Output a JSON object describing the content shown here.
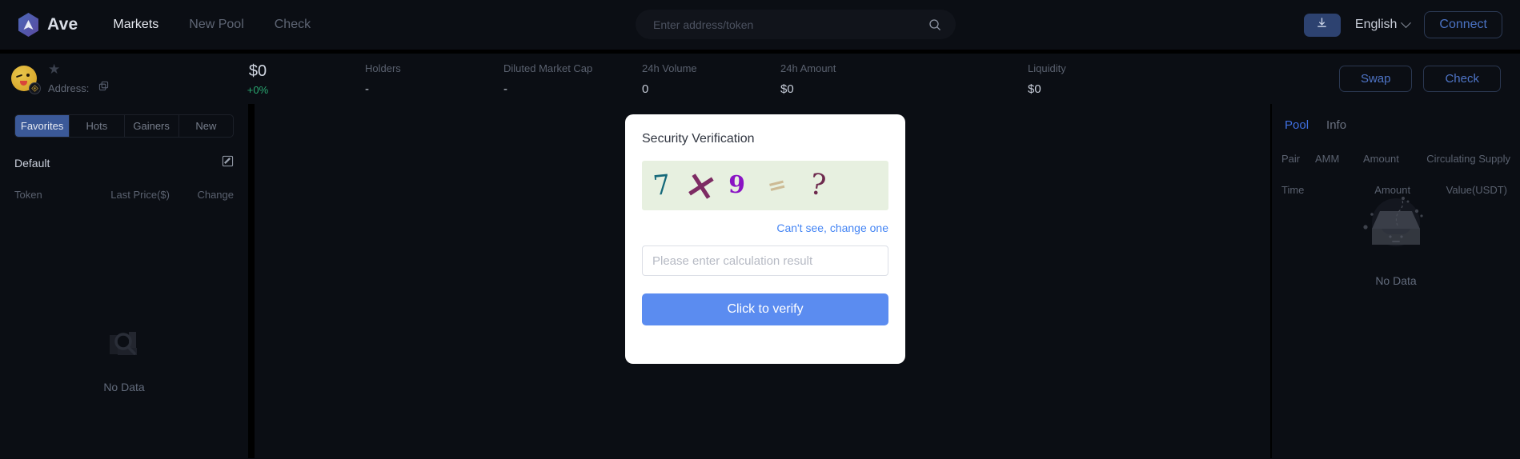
{
  "header": {
    "brand": "Ave",
    "logo_icon": "ave-hex-logo",
    "nav": [
      {
        "label": "Markets",
        "active": true
      },
      {
        "label": "New Pool",
        "active": false
      },
      {
        "label": "Check",
        "active": false
      }
    ],
    "search": {
      "placeholder": "Enter address/token",
      "value": "",
      "icon": "search-icon"
    },
    "download_icon": "download-icon",
    "language": "English",
    "language_chevron": "chevron-down-icon",
    "connect_label": "Connect"
  },
  "stats": {
    "avatar_icon": "token-avatar-emoji",
    "chain_badge_icon": "bnb-chain-icon",
    "favorite_icon": "star-icon",
    "address_label": "Address:",
    "copy_icon": "copy-icon",
    "price": "$0",
    "price_change": "+0%",
    "columns": [
      {
        "label": "Holders",
        "value": "-"
      },
      {
        "label": "Diluted Market Cap",
        "value": "-"
      },
      {
        "label": "24h Volume",
        "value": "0"
      },
      {
        "label": "24h Amount",
        "value": "$0"
      },
      {
        "label": "Liquidity",
        "value": "$0"
      }
    ],
    "swap_label": "Swap",
    "check_label": "Check"
  },
  "sidebar": {
    "tabs": [
      {
        "label": "Favorites",
        "active": true
      },
      {
        "label": "Hots",
        "active": false
      },
      {
        "label": "Gainers",
        "active": false
      },
      {
        "label": "New",
        "active": false
      }
    ],
    "list_name": "Default",
    "edit_icon": "edit-pencil-icon",
    "columns": {
      "token": "Token",
      "price": "Last Price($)",
      "change": "Change"
    },
    "empty_text": "No Data",
    "empty_icon": "no-data-search-box-icon"
  },
  "right_panel": {
    "tabs": [
      {
        "label": "Pool",
        "active": true
      },
      {
        "label": "Info",
        "active": false
      }
    ],
    "pool_columns": [
      "Pair",
      "AMM",
      "Amount",
      "Circulating Supply"
    ],
    "tx_columns": [
      "Time",
      "Amount",
      "Value(USDT)"
    ],
    "empty_text": "No Data",
    "empty_icon": "no-data-inbox-icon"
  },
  "modal": {
    "title": "Security Verification",
    "captcha": {
      "characters": [
        {
          "char": "7",
          "color": "#15697a",
          "size": 34,
          "rotate": -6,
          "weight": "normal"
        },
        {
          "char": "×",
          "color": "#7d2b63",
          "size": 48,
          "rotate": 12,
          "weight": "bold"
        },
        {
          "char": "9",
          "color": "#8a14c4",
          "size": 30,
          "rotate": 2,
          "weight": "bold"
        },
        {
          "char": "=",
          "color": "#cdbb95",
          "size": 28,
          "rotate": -14,
          "weight": "bold"
        },
        {
          "char": "?",
          "color": "#6e2a4e",
          "size": 36,
          "rotate": 9,
          "weight": "normal"
        }
      ],
      "expression": "7 × 9 = ?",
      "background_color": "#e7f0e0"
    },
    "refresh_link": "Can't see, change one",
    "input_placeholder": "Please enter calculation result",
    "input_value": "",
    "verify_label": "Click to verify"
  },
  "colors": {
    "accent_blue": "#3f6fe0",
    "button_blue": "#5b8cf0",
    "positive_green": "#2aa871",
    "page_bg": "#0b0e14"
  }
}
